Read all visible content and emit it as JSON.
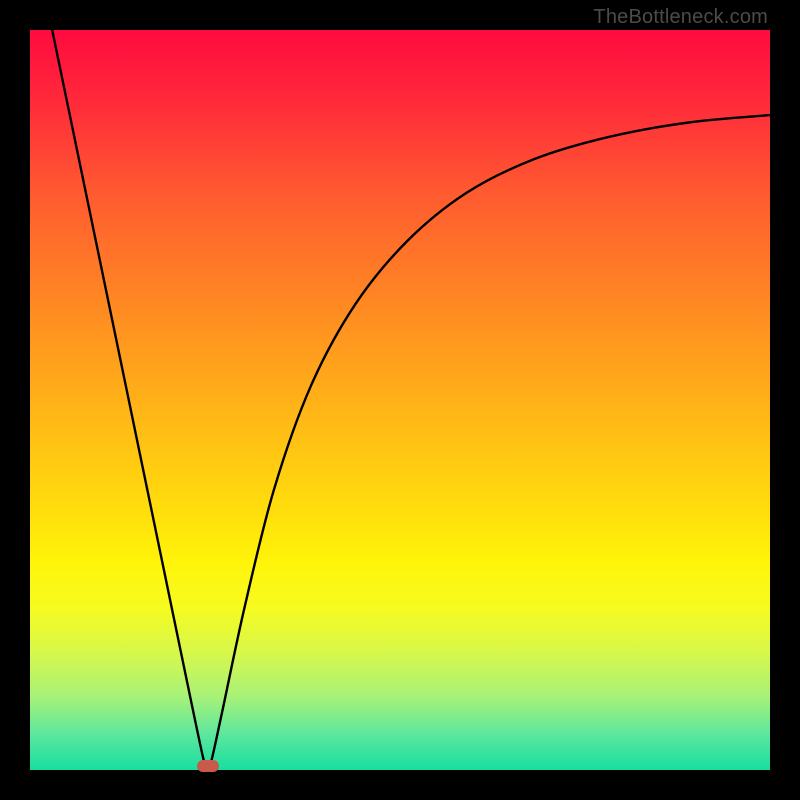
{
  "watermark": "TheBottleneck.com",
  "chart_data": {
    "type": "line",
    "title": "",
    "xlabel": "",
    "ylabel": "",
    "xlim": [
      0,
      1
    ],
    "ylim": [
      0,
      1
    ],
    "legend": false,
    "grid": false,
    "series": [
      {
        "name": "curve",
        "x": [
          0.03,
          0.06,
          0.09,
          0.12,
          0.15,
          0.18,
          0.21,
          0.235,
          0.24,
          0.245,
          0.26,
          0.29,
          0.33,
          0.38,
          0.44,
          0.51,
          0.59,
          0.68,
          0.78,
          0.89,
          1.0
        ],
        "y": [
          1.0,
          0.855,
          0.71,
          0.565,
          0.42,
          0.275,
          0.13,
          0.012,
          0.005,
          0.012,
          0.08,
          0.22,
          0.38,
          0.52,
          0.63,
          0.715,
          0.78,
          0.825,
          0.855,
          0.875,
          0.885
        ]
      }
    ],
    "marker": {
      "x": 0.24,
      "y": 0.005
    },
    "background_gradient": {
      "top_color": "#ff0a3f",
      "bottom_color": "#17dea1"
    }
  }
}
